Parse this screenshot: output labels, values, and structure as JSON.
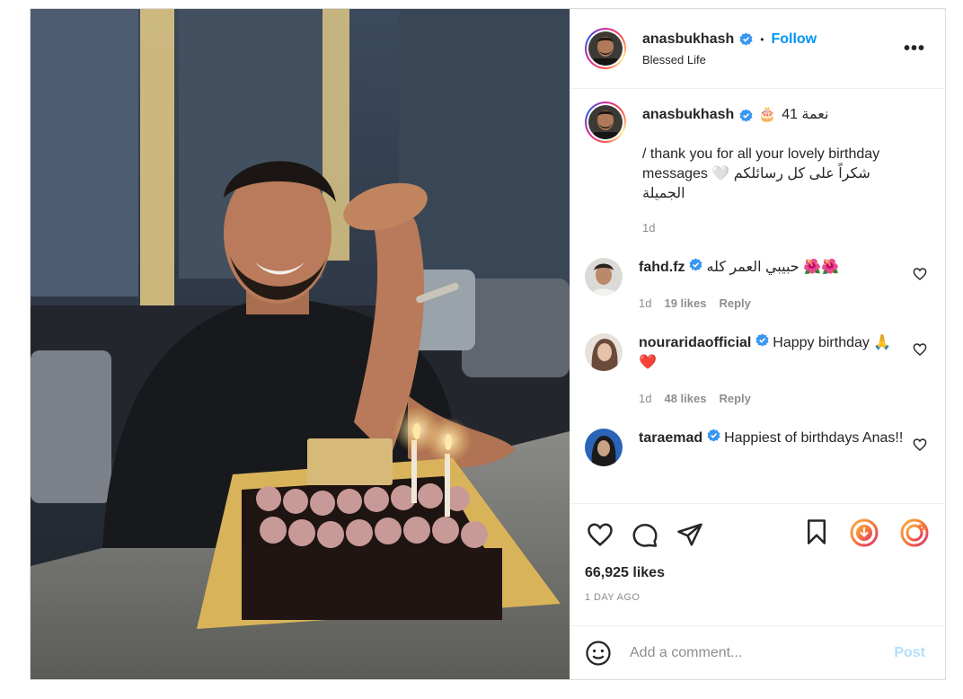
{
  "author": {
    "username": "anasbukhash",
    "follow_label": "Follow",
    "location": "Blessed Life",
    "dot": "•"
  },
  "caption": {
    "username": "anasbukhash",
    "rtl_head": "نعمة 41",
    "cake_emoji": "🎂",
    "text": "/ thank you for all your lovely birthday messages 🤍 شكراً على كل رسائلكم الجميلة",
    "time": "1d"
  },
  "comments": [
    {
      "username": "fahd.fz",
      "text": "حبيبي العمر كله 🌺🌺",
      "time": "1d",
      "likes": "19 likes",
      "reply": "Reply"
    },
    {
      "username": "nouraridaofficial",
      "text": "Happy birthday 🙏❤️",
      "time": "1d",
      "likes": "48 likes",
      "reply": "Reply"
    },
    {
      "username": "taraemad",
      "text": "Happiest of birthdays Anas!!",
      "time": "",
      "likes": "",
      "reply": ""
    }
  ],
  "stats": {
    "likes": "66,925 likes",
    "time_ago": "1 DAY AGO"
  },
  "composer": {
    "placeholder": "Add a comment...",
    "post_label": "Post"
  },
  "icons": {
    "like": "heart-icon",
    "comment": "comment-icon",
    "share": "share-icon",
    "save": "bookmark-icon",
    "download": "download-extension-icon",
    "repost": "repost-extension-icon",
    "verified": "verified-badge-icon",
    "more": "more-options-icon",
    "emoji": "emoji-icon"
  },
  "colors": {
    "link_blue": "#0095f6",
    "post_disabled": "#b2dffc",
    "meta_gray": "#8e8e8e",
    "ext_orange": "#f77737"
  }
}
